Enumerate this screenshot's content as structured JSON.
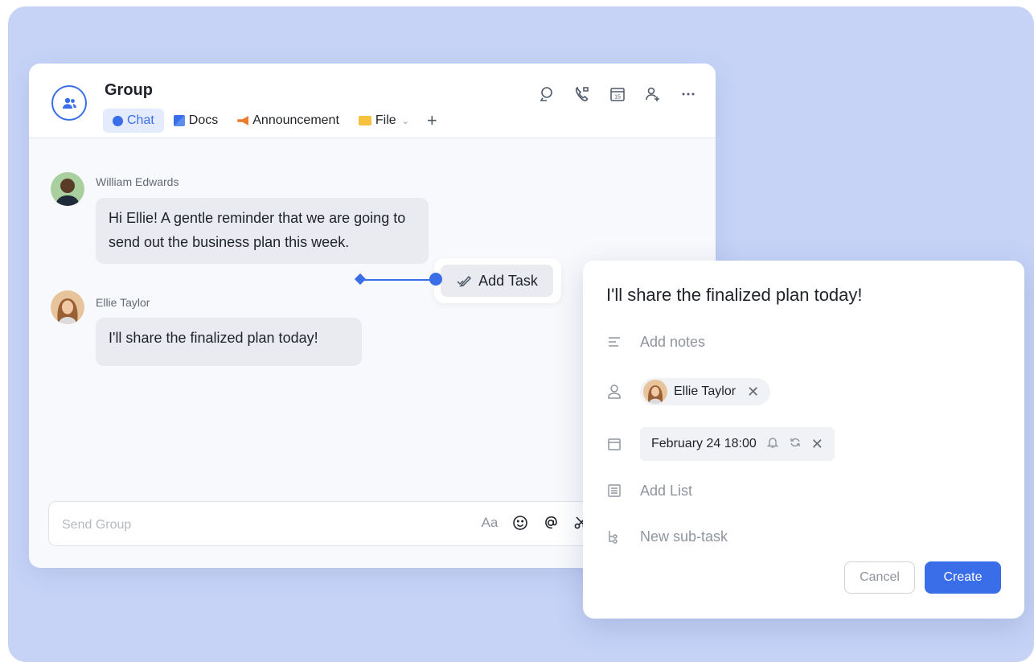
{
  "header": {
    "title": "Group",
    "tabs": [
      {
        "label": "Chat",
        "icon": "chat-icon"
      },
      {
        "label": "Docs",
        "icon": "docs-icon"
      },
      {
        "label": "Announcement",
        "icon": "announcement-icon"
      },
      {
        "label": "File",
        "icon": "folder-icon"
      }
    ],
    "add_tab_label": "+",
    "icons": [
      "search-icon",
      "phone-icon",
      "calendar-icon",
      "add-member-icon",
      "more-icon"
    ]
  },
  "messages": [
    {
      "sender": "William Edwards",
      "text": "Hi Ellie! A gentle reminder that we are going to send out the business plan this week."
    },
    {
      "sender": "Ellie Taylor",
      "text": "I'll share the finalized plan today!"
    }
  ],
  "add_task_label": "Add Task",
  "composer": {
    "placeholder": "Send Group",
    "format_label": "Aa"
  },
  "task_panel": {
    "title": "I'll share the finalized plan today!",
    "notes_placeholder": "Add notes",
    "assignee": "Ellie Taylor",
    "due": "February 24 18:00",
    "list_placeholder": "Add List",
    "subtask_placeholder": "New sub-task",
    "cancel_label": "Cancel",
    "create_label": "Create"
  },
  "colors": {
    "accent": "#3a6ee8",
    "background": "#c6d3f7",
    "bubble": "#e9ebf0"
  }
}
